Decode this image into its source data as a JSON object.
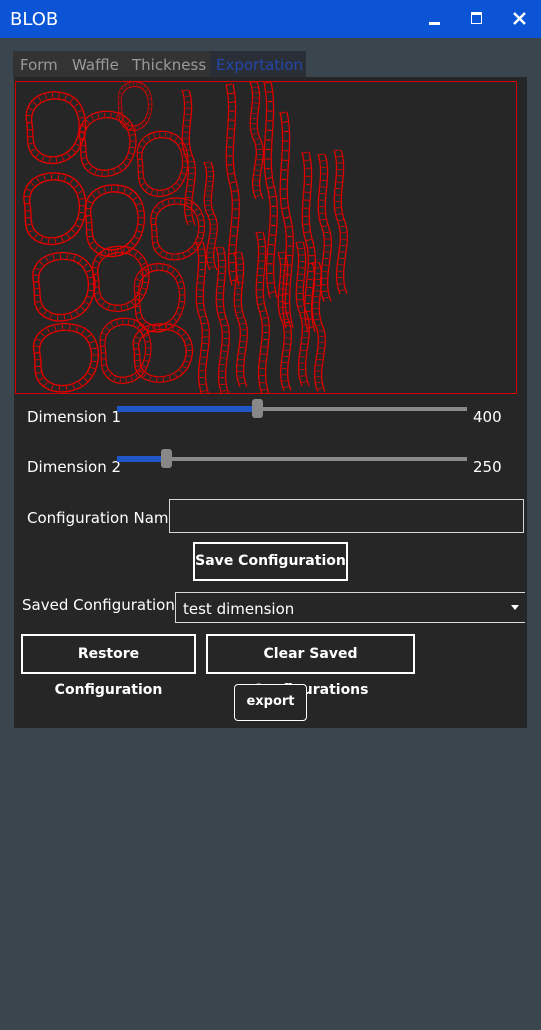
{
  "window": {
    "title": "BLOB"
  },
  "tabs": [
    {
      "label": "Form"
    },
    {
      "label": "Waffle"
    },
    {
      "label": "Thickness"
    },
    {
      "label": "Exportation",
      "active": true
    }
  ],
  "sliders": [
    {
      "label": "Dimension 1",
      "value": "400",
      "fraction": 0.4
    },
    {
      "label": "Dimension 2",
      "value": "250",
      "fraction": 0.14
    }
  ],
  "config": {
    "name_label": "Configuration Name",
    "name_value": "",
    "save_label": "Save Configuration",
    "saved_label": "Saved Configurations",
    "selected": "test dimension",
    "restore_label": "Restore Configuration",
    "clear_label": "Clear Saved Configurations"
  },
  "export_label": "export",
  "colors": {
    "titlebar": "#0a54d5",
    "accent": "#1f57c8",
    "preview_stroke": "#e00000",
    "background": "#3b454d",
    "panel": "#262626"
  }
}
